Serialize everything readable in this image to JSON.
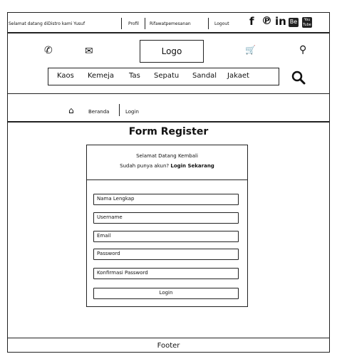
{
  "topbar": {
    "welcome": "Selamat datang diDistro kami Yusuf",
    "profile": "Profil",
    "order": "Rifawatpemesanan",
    "logout": "Logout",
    "social_fb": "f",
    "social_pinterest": "℗",
    "social_linkedin": "in",
    "social_behance": "Be",
    "social_youtube": "You Tube"
  },
  "header": {
    "logo": "Logo",
    "phone_icon": "✆",
    "mail_icon": "✉",
    "cart_icon": "🛒",
    "location_icon": "⚲"
  },
  "nav": {
    "items": [
      "Kaos",
      "Kemeja",
      "Tas",
      "Sepatu",
      "Sandal",
      "Jakaet"
    ],
    "search_icon": "⚲"
  },
  "breadcrumb": {
    "home_icon": "⌂",
    "home": "Beranda",
    "current": "Login"
  },
  "form": {
    "title": "Form Register",
    "welcome_line1": "Selamat Datang Kembali",
    "welcome_line2": "Sudah punya akun?",
    "welcome_link": "Login Sekarang",
    "fields": [
      "Nama Lengkap",
      "Username",
      "Email",
      "Password",
      "Konfirmasi Password"
    ],
    "submit": "Login"
  },
  "footer": {
    "text": "Footer"
  }
}
